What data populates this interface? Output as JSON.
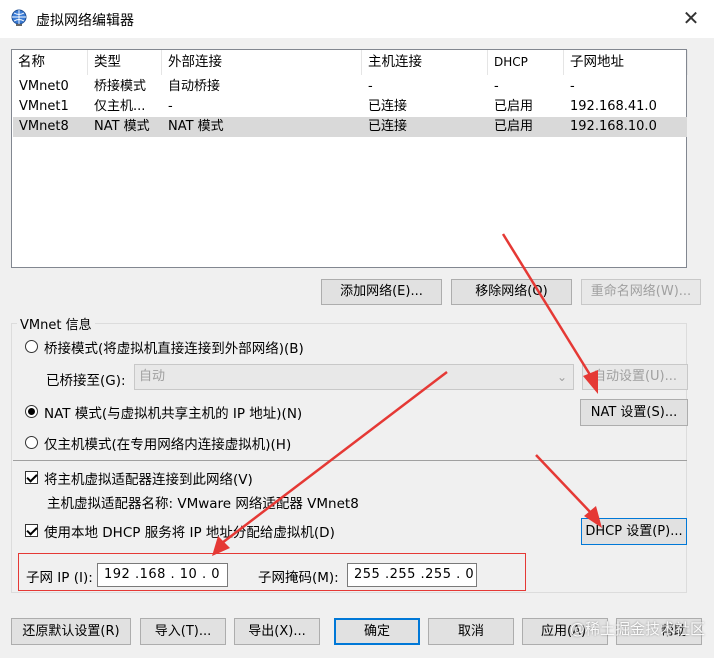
{
  "window": {
    "title": "虚拟网络编辑器",
    "close_icon": "close-icon"
  },
  "table": {
    "headers": [
      "名称",
      "类型",
      "外部连接",
      "主机连接",
      "DHCP",
      "子网地址"
    ],
    "rows": [
      [
        "VMnet0",
        "桥接模式",
        "自动桥接",
        "-",
        "-",
        "-"
      ],
      [
        "VMnet1",
        "仅主机...",
        "-",
        "已连接",
        "已启用",
        "192.168.41.0"
      ],
      [
        "VMnet8",
        "NAT 模式",
        "NAT 模式",
        "已连接",
        "已启用",
        "192.168.10.0"
      ]
    ],
    "selected_row": 2
  },
  "net_buttons": {
    "add": "添加网络(E)...",
    "remove": "移除网络(O)",
    "rename": "重命名网络(W)..."
  },
  "vmnet_info": {
    "title": "VMnet 信息",
    "bridged_label": "桥接模式(将虚拟机直接连接到外部网络)(B)",
    "bridged_to_label": "已桥接至(G):",
    "bridged_to_value": "自动",
    "auto_settings": "自动设置(U)...",
    "nat_label": "NAT 模式(与虚拟机共享主机的 IP 地址)(N)",
    "nat_settings": "NAT 设置(S)...",
    "hostonly_label": "仅主机模式(在专用网络内连接虚拟机)(H)",
    "selected_mode": "nat",
    "connect_adapter_label": "将主机虚拟适配器连接到此网络(V)",
    "connect_adapter_checked": true,
    "adapter_name": "主机虚拟适配器名称: VMware 网络适配器 VMnet8",
    "dhcp_label": "使用本地 DHCP 服务将 IP 地址分配给虚拟机(D)",
    "dhcp_checked": true,
    "dhcp_settings": "DHCP 设置(P)...",
    "subnet_ip_label": "子网 IP (I):",
    "subnet_ip_value": "192 .168 . 10  .  0",
    "subnet_mask_label": "子网掩码(M):",
    "subnet_mask_value": "255 .255 .255 .  0"
  },
  "footer": {
    "restore": "还原默认设置(R)",
    "import": "导入(T)...",
    "export": "导出(X)...",
    "ok": "确定",
    "cancel": "取消",
    "apply": "应用(A)",
    "help": "帮助"
  },
  "watermark": "@稀土掘金技术社区",
  "colors": {
    "annotation_red": "#e53935",
    "selection": "#d9d9d9",
    "accent": "#0078d7"
  }
}
